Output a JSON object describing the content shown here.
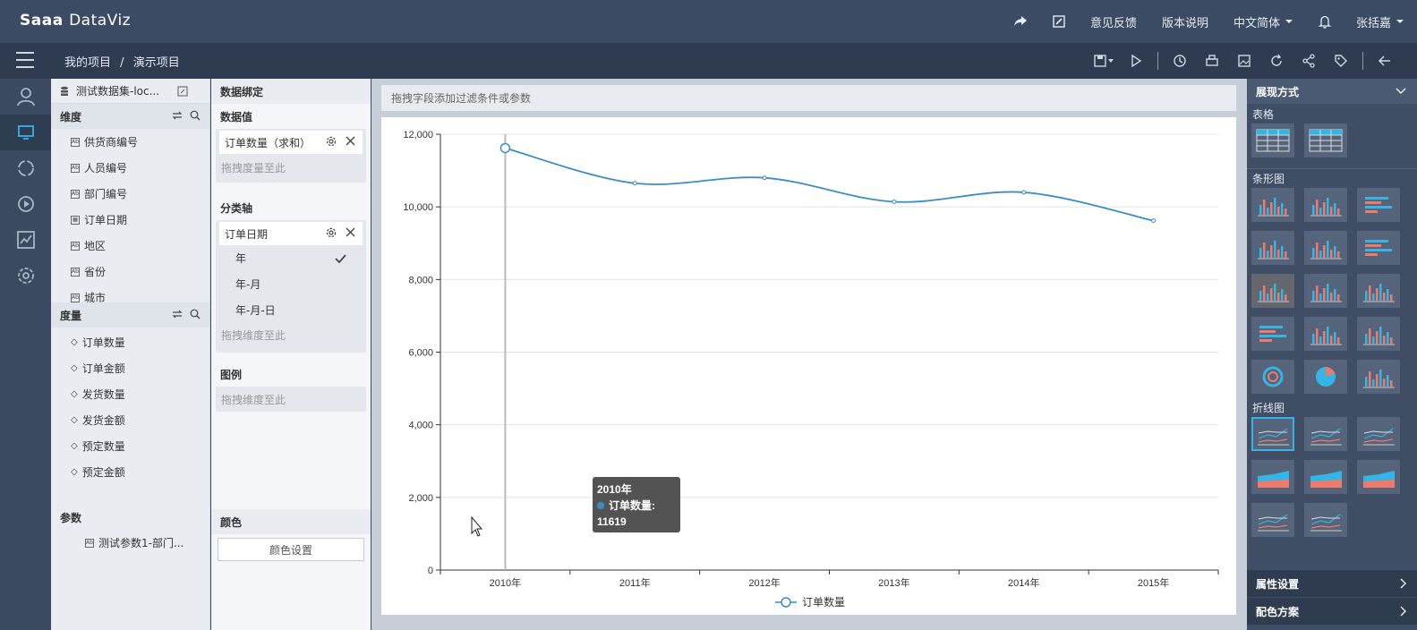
{
  "app": {
    "logo_a": "Sa",
    "logo_b": "a",
    "logo_c": "DataViz"
  },
  "topbar": {
    "feedback": "意见反馈",
    "version": "版本说明",
    "language": "中文简体",
    "user": "张括嘉"
  },
  "breadcrumb": {
    "root": "我的项目",
    "sep": "/",
    "current": "演示项目"
  },
  "fields": {
    "dataset": "测试数据集-loc...",
    "dimension_label": "维度",
    "dimensions": [
      "供货商编号",
      "人员编号",
      "部门编号",
      "订单日期",
      "地区",
      "省份",
      "城市"
    ],
    "measure_label": "度量",
    "measures": [
      "订单数量",
      "订单金额",
      "发货数量",
      "发货金额",
      "预定数量",
      "预定金额"
    ],
    "param_label": "参数",
    "params": [
      "测试参数1-部门..."
    ]
  },
  "binding": {
    "title": "数据绑定",
    "value_label": "数据值",
    "value_chip": "订单数量（求和）",
    "value_drop": "拖拽度量至此",
    "axis_label": "分类轴",
    "axis_chip": "订单日期",
    "axis_options": [
      "年",
      "年-月",
      "年-月-日"
    ],
    "axis_drop": "拖拽维度至此",
    "legend_label": "图例",
    "legend_drop": "拖拽维度至此",
    "color_label": "颜色",
    "color_button": "颜色设置"
  },
  "filterbar": "拖拽字段添加过滤条件或参数",
  "chart_data": {
    "type": "line",
    "categories": [
      "2010年",
      "2011年",
      "2012年",
      "2013年",
      "2014年",
      "2015年"
    ],
    "series": [
      {
        "name": "订单数量",
        "values": [
          11619,
          10650,
          10800,
          10140,
          10400,
          9620
        ]
      }
    ],
    "ylim": [
      0,
      12000
    ],
    "yticks": [
      "0",
      "2,000",
      "4,000",
      "6,000",
      "8,000",
      "10,000",
      "12,000"
    ],
    "grid": true,
    "legend": "bottom",
    "color": "#3c8dc3",
    "tooltip": {
      "title": "2010年",
      "label": "订单数量:",
      "value": "11619"
    }
  },
  "rightpanel": {
    "title": "展现方式",
    "group_table": "表格",
    "group_bar": "条形图",
    "group_line": "折线图",
    "attr": "属性设置",
    "palette": "配色方案"
  }
}
